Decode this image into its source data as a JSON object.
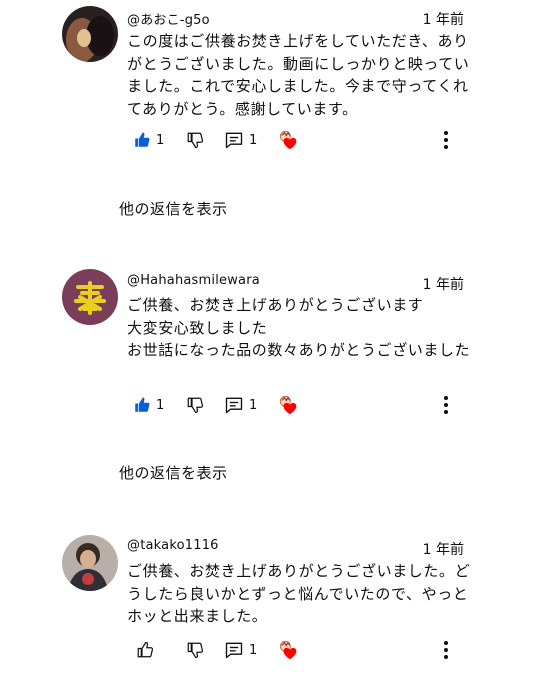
{
  "comments": [
    {
      "handle": "@あおこ-g5o",
      "time": "1 年前",
      "text": "この度はご供養お焚き上げをしていただき、ありがとうございました。動画にしっかりと映っていました。これで安心しました。今まで守ってくれてありがとう。感謝しています。",
      "likes": "1",
      "replies_count": "1",
      "liked": true,
      "avatar_color": "#6b4a3a"
    },
    {
      "handle": "@Hahahasmilewara",
      "time": "1 年前",
      "text": "ご供養、お焚き上げありがとうございます\n大変安心致しました\nお世話になった品の数々ありがとうございました",
      "likes": "1",
      "replies_count": "1",
      "liked": true,
      "avatar_color": "#7a3d5a"
    },
    {
      "handle": "@takako1116",
      "time": "1 年前",
      "text": "ご供養、お焚き上げありがとうございました。どうしたら良いかとずっと悩んでいたので、やっとホッと出来ました。",
      "likes": "",
      "replies_count": "1",
      "liked": false,
      "avatar_color": "#3a3a40"
    }
  ],
  "show_replies_label": "他の返信を表示",
  "colors": {
    "like_blue": "#065fd4",
    "heart_red": "#ff0000"
  }
}
